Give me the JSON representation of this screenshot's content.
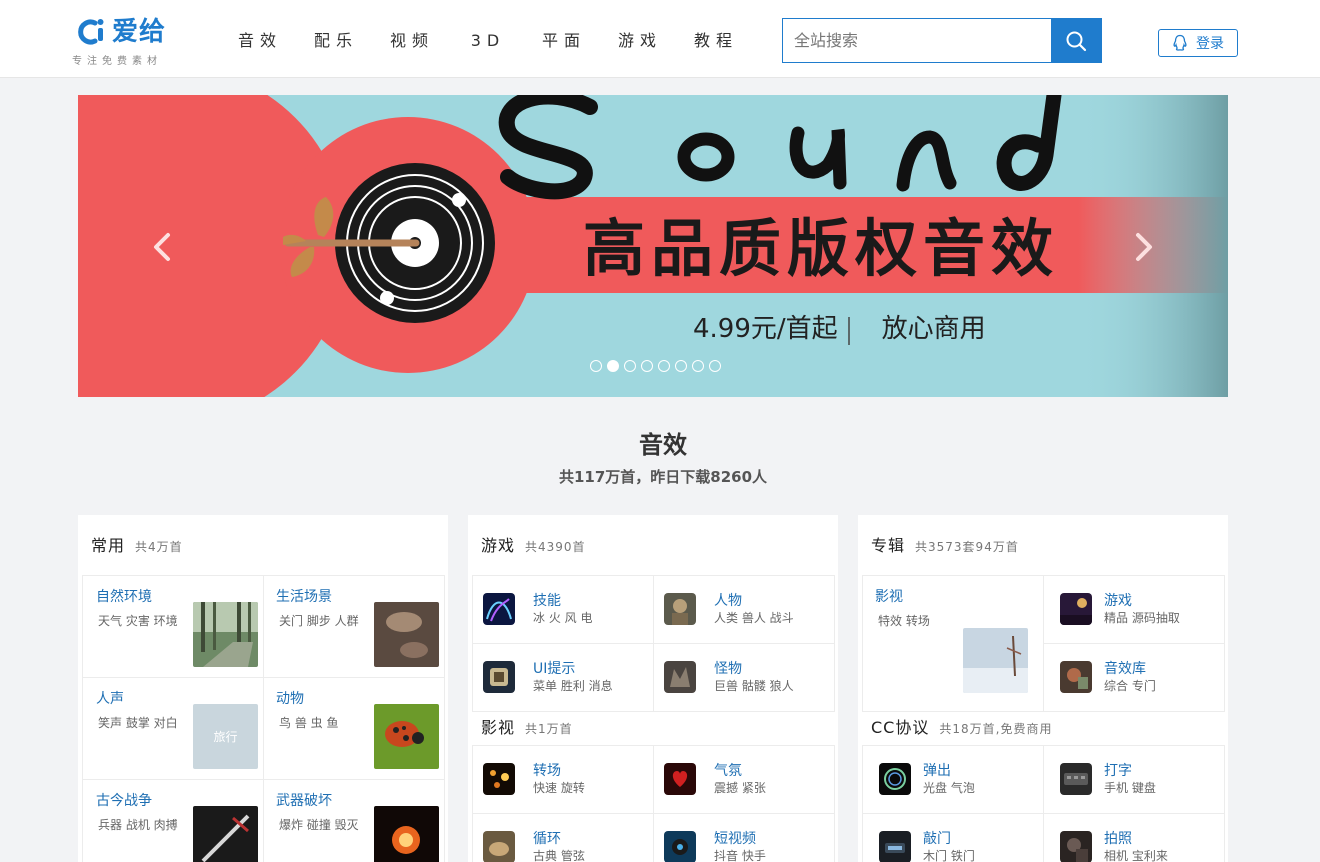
{
  "header": {
    "logo_text": "爱给",
    "logo_slogan": "专注免费素材",
    "nav": [
      "音效",
      "配乐",
      "视频",
      "3D",
      "平面",
      "游戏",
      "教程"
    ],
    "search_placeholder": "全站搜索",
    "login_label": "登录"
  },
  "banner": {
    "word": "Sound",
    "headline": "高品质版权音效",
    "price_text": "4.99元/首起",
    "slogan_text": "放心商用",
    "slide_count": 8,
    "active_slide": 2
  },
  "section": {
    "title": "音效",
    "subtitle": "共117万首，昨日下载8260人"
  },
  "cards": {
    "common": {
      "title": "常用",
      "count": "共4万首",
      "items": [
        {
          "title": "自然环境",
          "tags": "天气 灾害 环境"
        },
        {
          "title": "生活场景",
          "tags": "关门 脚步 人群"
        },
        {
          "title": "人声",
          "tags": "笑声 鼓掌 对白",
          "thumb_text": "旅行"
        },
        {
          "title": "动物",
          "tags": "鸟 兽 虫 鱼"
        },
        {
          "title": "古今战争",
          "tags": "兵器 战机 肉搏"
        },
        {
          "title": "武器破坏",
          "tags": "爆炸 碰撞 毁灭"
        }
      ]
    },
    "game": {
      "title": "游戏",
      "count": "共4390首",
      "items": [
        {
          "title": "技能",
          "tags": "冰 火 风 电"
        },
        {
          "title": "人物",
          "tags": "人类 兽人 战斗"
        },
        {
          "title": "UI提示",
          "tags": "菜单 胜利 消息"
        },
        {
          "title": "怪物",
          "tags": "巨兽 骷髅 狼人"
        }
      ]
    },
    "film": {
      "title": "影视",
      "count": "共1万首",
      "items": [
        {
          "title": "转场",
          "tags": "快速 旋转"
        },
        {
          "title": "气氛",
          "tags": "震撼 紧张"
        },
        {
          "title": "循环",
          "tags": "古典 管弦"
        },
        {
          "title": "短视频",
          "tags": "抖音 快手"
        }
      ]
    },
    "album": {
      "title": "专辑",
      "count": "共3573套94万首",
      "items": [
        {
          "title": "影视",
          "tags": "特效 转场"
        },
        {
          "title": "游戏",
          "tags": "精品 源码抽取"
        },
        {
          "title": "音效库",
          "tags": "综合 专门"
        }
      ]
    },
    "cc": {
      "title": "CC协议",
      "count": "共18万首,免费商用",
      "items": [
        {
          "title": "弹出",
          "tags": "光盘 气泡"
        },
        {
          "title": "打字",
          "tags": "手机 键盘"
        },
        {
          "title": "敲门",
          "tags": "木门 铁门"
        },
        {
          "title": "拍照",
          "tags": "相机 宝利来"
        }
      ]
    }
  },
  "colors": {
    "brand_blue": "#1f7ccd",
    "banner_sky": "#9fd7de",
    "banner_red": "#f05a5b",
    "link_blue": "#1f6fb3"
  }
}
